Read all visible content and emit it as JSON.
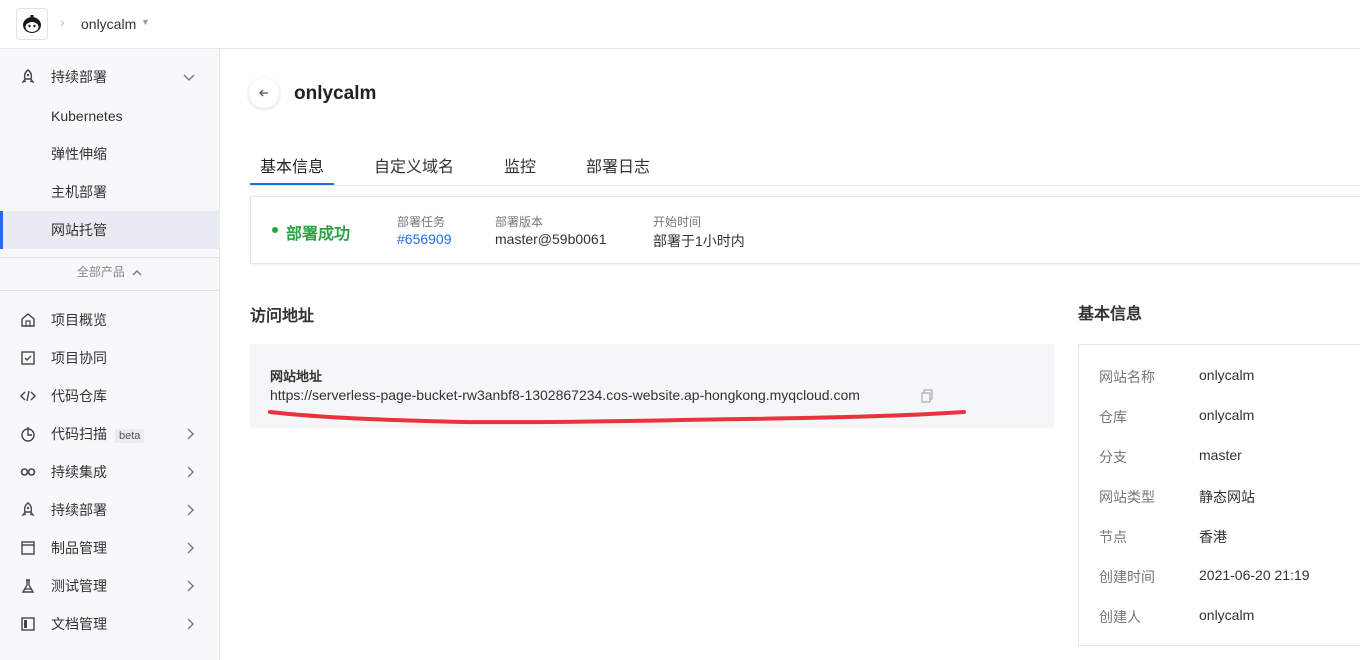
{
  "header": {
    "project_name": "onlycalm"
  },
  "sidebar": {
    "cd_section": {
      "label": "持续部署"
    },
    "sub_items": [
      {
        "label": "Kubernetes"
      },
      {
        "label": "弹性伸缩"
      },
      {
        "label": "主机部署"
      },
      {
        "label": "网站托管"
      }
    ],
    "all_products_label": "全部产品",
    "items": [
      {
        "label": "项目概览",
        "icon": "home-icon"
      },
      {
        "label": "项目协同",
        "icon": "checkbox-icon"
      },
      {
        "label": "代码仓库",
        "icon": "code-icon"
      },
      {
        "label": "代码扫描",
        "icon": "scan-icon",
        "badge": "beta"
      },
      {
        "label": "持续集成",
        "icon": "infinity-icon"
      },
      {
        "label": "持续部署",
        "icon": "rocket-icon"
      },
      {
        "label": "制品管理",
        "icon": "box-icon"
      },
      {
        "label": "测试管理",
        "icon": "flask-icon"
      },
      {
        "label": "文档管理",
        "icon": "document-icon"
      }
    ]
  },
  "main": {
    "title": "onlycalm",
    "tabs": [
      {
        "label": "基本信息"
      },
      {
        "label": "自定义域名"
      },
      {
        "label": "监控"
      },
      {
        "label": "部署日志"
      }
    ],
    "status": {
      "text": "部署成功",
      "task_label": "部署任务",
      "task_value": "#656909",
      "version_label": "部署版本",
      "version_value": "master@59b0061",
      "time_label": "开始时间",
      "time_value": "部署于1小时内"
    },
    "access": {
      "title": "访问地址",
      "url_label": "网站地址",
      "url": "https://serverless-page-bucket-rw3anbf8-1302867234.cos-website.ap-hongkong.myqcloud.com"
    },
    "info": {
      "title": "基本信息",
      "rows": [
        {
          "key": "网站名称",
          "value": "onlycalm"
        },
        {
          "key": "仓库",
          "value": "onlycalm"
        },
        {
          "key": "分支",
          "value": "master"
        },
        {
          "key": "网站类型",
          "value": "静态网站"
        },
        {
          "key": "节点",
          "value": "香港"
        },
        {
          "key": "创建时间",
          "value": "2021-06-20 21:19"
        },
        {
          "key": "创建人",
          "value": "onlycalm"
        }
      ]
    }
  },
  "colors": {
    "accent": "#1e6fe6",
    "success": "#2ba245",
    "annotation": "#e8323c"
  }
}
